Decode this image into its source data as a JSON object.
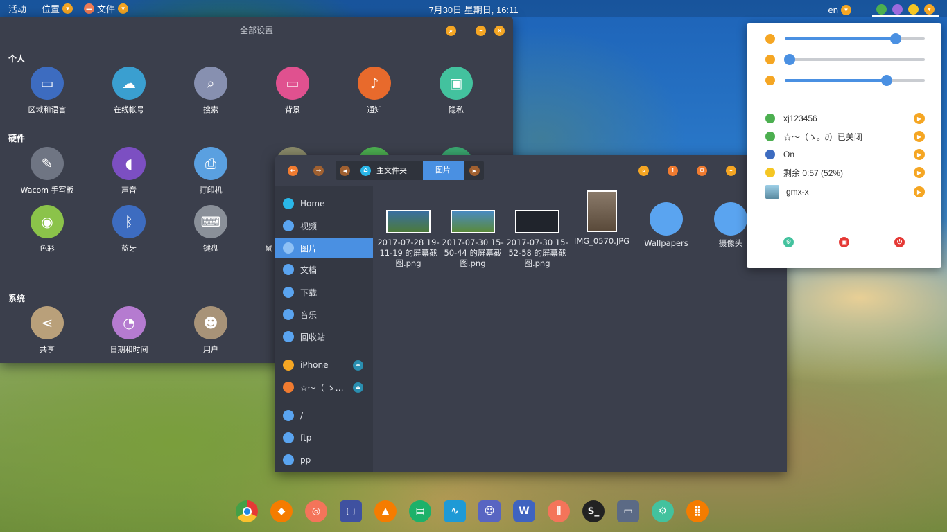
{
  "topbar": {
    "activities": "活动",
    "places": "位置",
    "files_menu": "文件",
    "clock": "7月30日 星期日, 16:11",
    "lang": "en"
  },
  "settings": {
    "title": "全部设置",
    "sections": {
      "personal": "个人",
      "hardware": "硬件",
      "system": "系统"
    },
    "personal_items": [
      "区域和语言",
      "在线帐号",
      "搜索",
      "背景",
      "通知",
      "隐私"
    ],
    "hardware_items": [
      "Wacom 手写板",
      "声音",
      "打印机",
      "色彩",
      "蓝牙",
      "键盘",
      "鼠"
    ],
    "system_items": [
      "共享",
      "日期和时间",
      "用户"
    ]
  },
  "files": {
    "breadcrumb": [
      "主文件夹",
      "图片"
    ],
    "sidebar": [
      "Home",
      "视频",
      "图片",
      "文档",
      "下载",
      "音乐",
      "回收站",
      "iPhone",
      "☆～（ ゝ…",
      "/",
      "ftp",
      "pp"
    ],
    "items": [
      {
        "name": "2017-07-28 19-11-19 的屏幕截图.png",
        "kind": "screenshot"
      },
      {
        "name": "2017-07-30 15-50-44 的屏幕截图.png",
        "kind": "screenshot"
      },
      {
        "name": "2017-07-30 15-52-58 的屏幕截图.png",
        "kind": "screenshot"
      },
      {
        "name": "IMG_0570.JPG",
        "kind": "photo"
      },
      {
        "name": "Wallpapers",
        "kind": "folder"
      },
      {
        "name": "摄像头",
        "kind": "folder"
      }
    ]
  },
  "popup": {
    "sliders": {
      "volume": 0.79,
      "mic": 0.03,
      "brightness": 0.73
    },
    "rows": [
      "xj123456",
      "☆～（ゝ。∂）已关闭",
      "On",
      "剩余 0:57 (52%)",
      "gmx-x"
    ]
  },
  "dock": [
    "chrome-icon",
    "fox-icon",
    "disk-icon",
    "screenshot-icon",
    "vlc-icon",
    "document-icon",
    "monitor-icon",
    "discord-icon",
    "wps-icon",
    "mixer-icon",
    "terminal-icon",
    "files-icon",
    "settings-icon",
    "apps-icon"
  ],
  "colors": {
    "accent": "#4a90e2",
    "orange": "#f5a623",
    "panel": "#3b3f4c",
    "sidebar": "#343843"
  }
}
